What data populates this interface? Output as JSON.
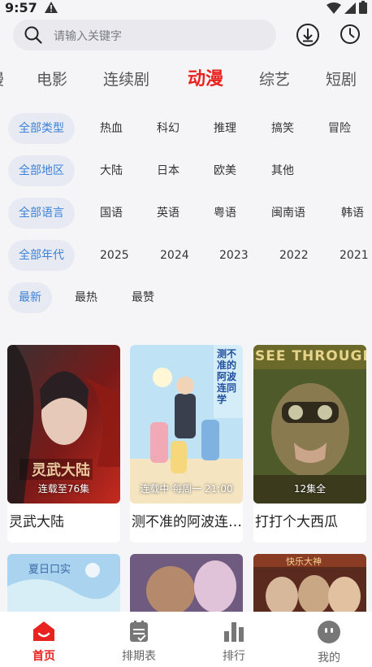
{
  "status": {
    "time": "9:57"
  },
  "search": {
    "placeholder": "请输入关键字"
  },
  "tabs": [
    {
      "label": "漫",
      "active": false
    },
    {
      "label": "电影",
      "active": false
    },
    {
      "label": "连续剧",
      "active": false
    },
    {
      "label": "动漫",
      "active": true
    },
    {
      "label": "综艺",
      "active": false
    },
    {
      "label": "短剧",
      "active": false
    }
  ],
  "filters": {
    "type": [
      "全部类型",
      "热血",
      "科幻",
      "推理",
      "搞笑",
      "冒险"
    ],
    "region": [
      "全部地区",
      "大陆",
      "日本",
      "欧美",
      "其他"
    ],
    "language": [
      "全部语言",
      "国语",
      "英语",
      "粤语",
      "闽南语",
      "韩语"
    ],
    "year": [
      "全部年代",
      "2025",
      "2024",
      "2023",
      "2022",
      "2021"
    ],
    "sort": [
      "最新",
      "最热",
      "最赞"
    ]
  },
  "cards": [
    {
      "title": "灵武大陆",
      "badge": "连载至76集",
      "poster_text": "灵武大陆"
    },
    {
      "title": "测不准的阿波连同学",
      "badge": "连载中 每周一 21:00",
      "poster_text": "测不准的阿波连同学"
    },
    {
      "title": "打打个大西瓜",
      "badge": "12集全",
      "poster_text": "SEE THROUGH"
    }
  ],
  "row2": [
    {
      "poster_text": "夏日口实"
    },
    {
      "poster_text": ""
    },
    {
      "poster_text": "快乐大神"
    }
  ],
  "nav": [
    {
      "label": "首页",
      "active": true
    },
    {
      "label": "排期表",
      "active": false
    },
    {
      "label": "排行",
      "active": false
    },
    {
      "label": "我的",
      "active": false
    }
  ],
  "colors": {
    "accent": "#e8231f",
    "chip_selected_text": "#3b82d6",
    "chip_selected_bg": "#e8eaf3"
  }
}
